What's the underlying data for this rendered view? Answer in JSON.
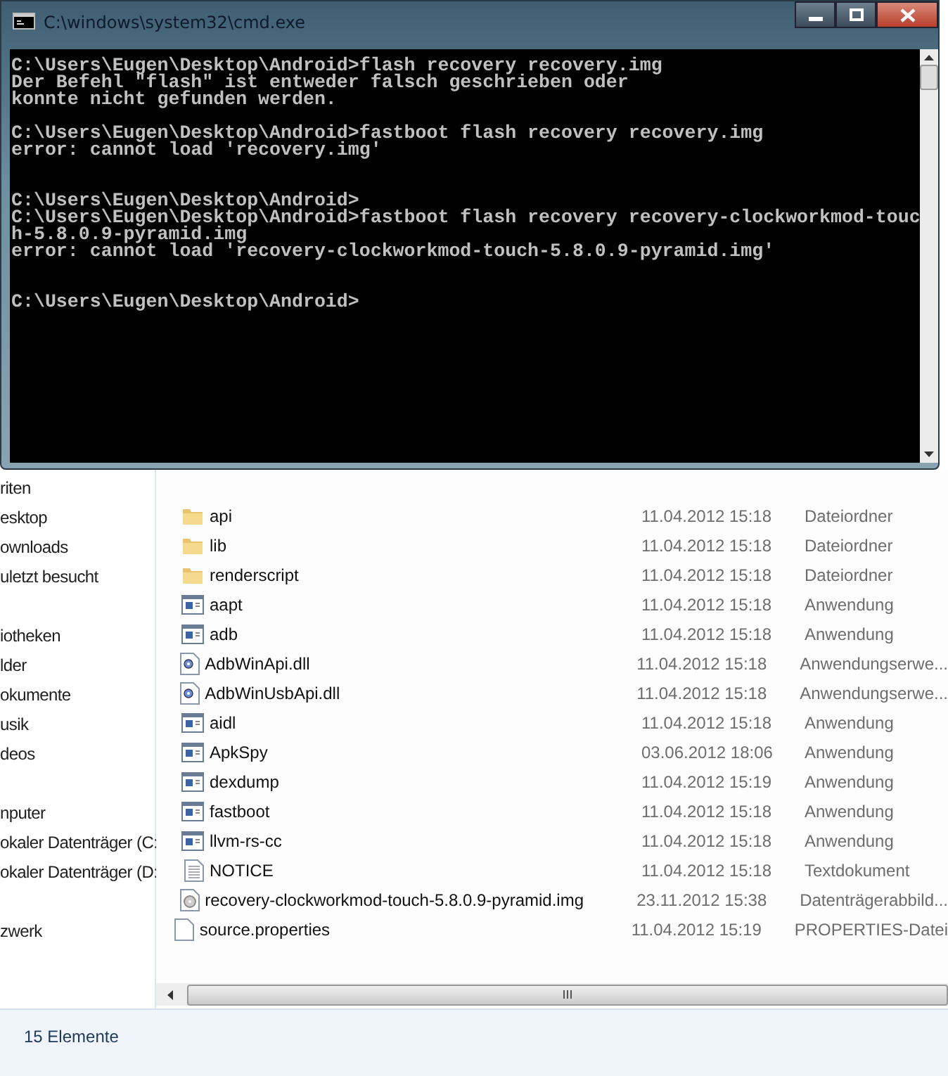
{
  "console_window": {
    "title": "C:\\windows\\system32\\cmd.exe",
    "lines": [
      {
        "kind": "text",
        "text": "C:\\Users\\Eugen\\Desktop\\Android>flash recovery recovery.img"
      },
      {
        "kind": "text",
        "text": "Der Befehl \"flash\" ist entweder falsch geschrieben oder"
      },
      {
        "kind": "text",
        "text": "konnte nicht gefunden werden."
      },
      {
        "kind": "blank"
      },
      {
        "kind": "text",
        "text": "C:\\Users\\Eugen\\Desktop\\Android>fastboot flash recovery recovery.img"
      },
      {
        "kind": "text",
        "text": "error: cannot load 'recovery.img'"
      },
      {
        "kind": "blank"
      },
      {
        "kind": "blank"
      },
      {
        "kind": "text",
        "text": "C:\\Users\\Eugen\\Desktop\\Android>"
      },
      {
        "kind": "text",
        "text": "C:\\Users\\Eugen\\Desktop\\Android>fastboot flash recovery recovery-clockworkmod-touc"
      },
      {
        "kind": "text",
        "text": "h-5.8.0.9-pyramid.img"
      },
      {
        "kind": "text",
        "text": "error: cannot load 'recovery-clockworkmod-touch-5.8.0.9-pyramid.img'"
      },
      {
        "kind": "blank"
      },
      {
        "kind": "blank"
      },
      {
        "kind": "text",
        "text": "C:\\Users\\Eugen\\Desktop\\Android>"
      }
    ]
  },
  "sidebar": {
    "groups": [
      {
        "items": [
          "riten",
          "esktop",
          "ownloads",
          "uletzt besucht"
        ]
      },
      {
        "items": [
          "iotheken",
          "lder",
          "okumente",
          "usik",
          "deos"
        ]
      },
      {
        "items": [
          "nputer",
          "okaler Datenträger (C:",
          "okaler Datenträger (D:"
        ]
      },
      {
        "items": [
          "zwerk"
        ]
      }
    ]
  },
  "files": [
    {
      "kind": "folder",
      "name": "api",
      "date": "11.04.2012 15:18",
      "type": "Dateiordner"
    },
    {
      "kind": "folder",
      "name": "lib",
      "date": "11.04.2012 15:18",
      "type": "Dateiordner"
    },
    {
      "kind": "folder",
      "name": "renderscript",
      "date": "11.04.2012 15:18",
      "type": "Dateiordner"
    },
    {
      "kind": "app",
      "name": "aapt",
      "date": "11.04.2012 15:18",
      "type": "Anwendung"
    },
    {
      "kind": "app",
      "name": "adb",
      "date": "11.04.2012 15:18",
      "type": "Anwendung"
    },
    {
      "kind": "dll",
      "name": "AdbWinApi.dll",
      "date": "11.04.2012 15:18",
      "type": "Anwendungserwe..."
    },
    {
      "kind": "dll",
      "name": "AdbWinUsbApi.dll",
      "date": "11.04.2012 15:18",
      "type": "Anwendungserwe..."
    },
    {
      "kind": "app",
      "name": "aidl",
      "date": "11.04.2012 15:18",
      "type": "Anwendung"
    },
    {
      "kind": "app",
      "name": "ApkSpy",
      "date": "03.06.2012 18:06",
      "type": "Anwendung"
    },
    {
      "kind": "app",
      "name": "dexdump",
      "date": "11.04.2012 15:19",
      "type": "Anwendung"
    },
    {
      "kind": "app",
      "name": "fastboot",
      "date": "11.04.2012 15:18",
      "type": "Anwendung"
    },
    {
      "kind": "app",
      "name": "llvm-rs-cc",
      "date": "11.04.2012 15:18",
      "type": "Anwendung"
    },
    {
      "kind": "text",
      "name": "NOTICE",
      "date": "11.04.2012 15:18",
      "type": "Textdokument"
    },
    {
      "kind": "image",
      "name": "recovery-clockworkmod-touch-5.8.0.9-pyramid.img",
      "date": "23.11.2012 15:38",
      "type": "Datenträgerabbild..."
    },
    {
      "kind": "file",
      "name": "source.properties",
      "date": "11.04.2012 15:19",
      "type": "PROPERTIES-Datei"
    }
  ],
  "status_bar": {
    "text": "15 Elemente"
  }
}
